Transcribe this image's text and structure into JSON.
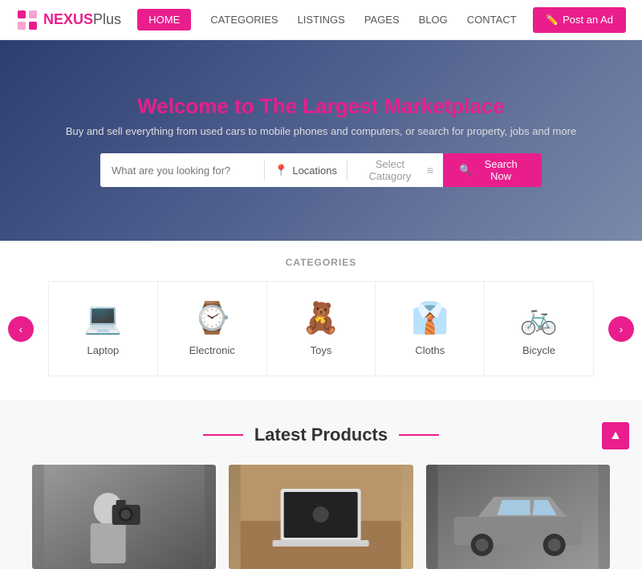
{
  "navbar": {
    "logo_text": "NEXUS",
    "logo_sub": "Plus",
    "links": [
      {
        "label": "HOME",
        "active": true
      },
      {
        "label": "CATEGORIES",
        "active": false
      },
      {
        "label": "LISTINGS",
        "active": false
      },
      {
        "label": "PAGES",
        "active": false
      },
      {
        "label": "BLOG",
        "active": false
      },
      {
        "label": "CONTACT",
        "active": false
      }
    ],
    "post_btn": "Post an Ad"
  },
  "hero": {
    "title_plain": "Welcome to The Largest ",
    "title_accent": "Marketplace",
    "subtitle": "Buy and sell everything from used cars to mobile phones and computers, or search for property, jobs and more",
    "search_placeholder": "What are you looking for?",
    "location_btn": "Locations",
    "category_btn": "Select Catagory",
    "search_btn": "Search Now"
  },
  "categories": {
    "section_title": "CATEGORIES",
    "items": [
      {
        "label": "Laptop",
        "icon": "💻"
      },
      {
        "label": "Electronic",
        "icon": "⌚"
      },
      {
        "label": "Toys",
        "icon": "🧸"
      },
      {
        "label": "Cloths",
        "icon": "👔"
      },
      {
        "label": "Bicycle",
        "icon": "🚲"
      }
    ],
    "prev_btn": "‹",
    "next_btn": "›"
  },
  "latest_products": {
    "title": "Latest Products",
    "products": [
      {
        "icon": "📷",
        "bg": "camera"
      },
      {
        "icon": "💻",
        "bg": "laptop"
      },
      {
        "icon": "🚗",
        "bg": "car"
      }
    ]
  },
  "scroll_top": "▲"
}
